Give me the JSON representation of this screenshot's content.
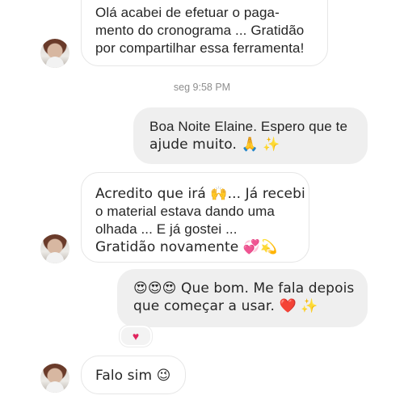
{
  "timestamp": "seg 9:58 PM",
  "messages": [
    {
      "id": "m1",
      "direction": "incoming",
      "lines": [
        "Olá acabei de efetuar o paga-",
        "mento do cronograma ... Gratidão",
        "por compartilhar essa ferramenta!"
      ]
    },
    {
      "id": "m2",
      "direction": "outgoing",
      "lines": [
        "Boa Noite Elaine. Espero que te",
        "ajude muito. 🙏 ✨"
      ]
    },
    {
      "id": "m3",
      "direction": "incoming",
      "lines": [
        "Acredito que irá 🙌... Já recebi",
        "o material estava dando uma",
        "olhada ... E já gostei ...",
        "Gratidão novamente 💞💫"
      ]
    },
    {
      "id": "m4",
      "direction": "outgoing",
      "lines": [
        "😍😍😍 Que bom. Me fala depois",
        "que começar a usar. ❤️ ✨"
      ],
      "reaction": "♥"
    },
    {
      "id": "m5",
      "direction": "incoming",
      "lines": [
        "Falo sim 😉"
      ]
    }
  ],
  "colors": {
    "incoming_bubble": "#ffffff",
    "incoming_border": "#e6e6e6",
    "outgoing_bubble": "#efefef",
    "text": "#262626",
    "timestamp": "#8e8e8e",
    "reaction_heart": "#e0245e"
  }
}
